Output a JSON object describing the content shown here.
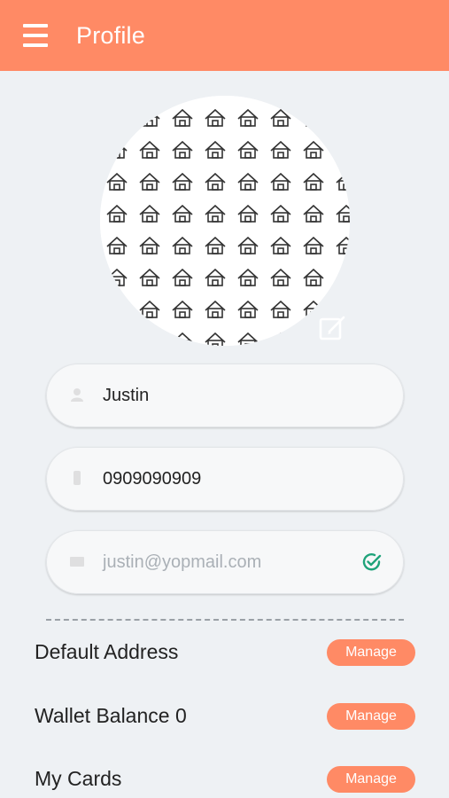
{
  "header": {
    "title": "Profile",
    "background": "#ff8a65"
  },
  "profile": {
    "name": "Justin",
    "phone": "0909090909",
    "email_placeholder": "justin@yopmail.com"
  },
  "sections": {
    "address_label": "Default Address",
    "wallet_label": "Wallet Balance 0",
    "cards_label": "My Cards",
    "manage_label": "Manage"
  },
  "icons": {
    "menu": "hamburger-menu-icon",
    "edit": "edit-icon",
    "verified": "check-circle-icon"
  },
  "colors": {
    "accent": "#ff8a65",
    "background": "#eef1f4",
    "verified": "#1fa37a"
  }
}
